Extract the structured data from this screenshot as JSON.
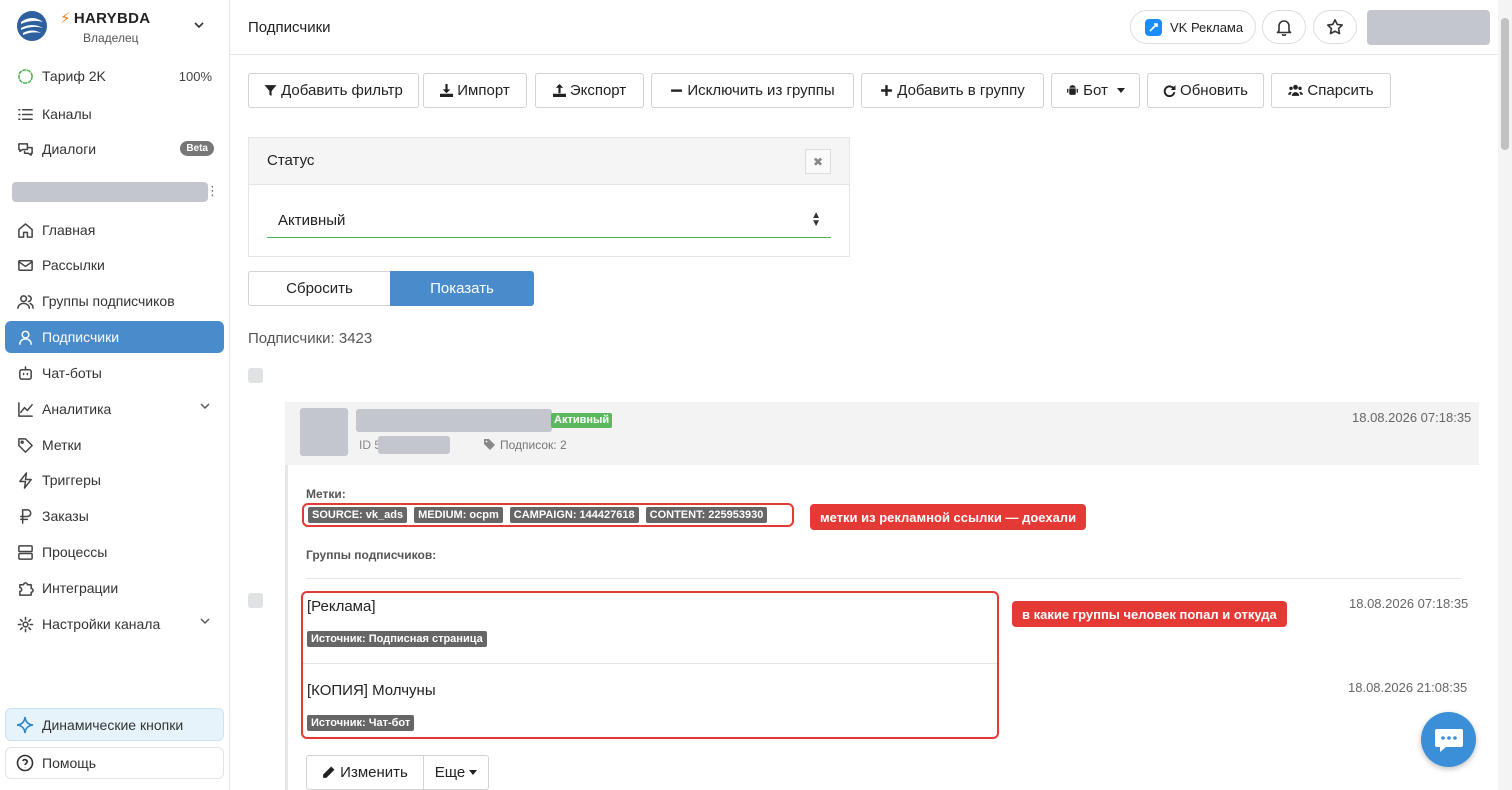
{
  "brand": {
    "name": "HARYBDA",
    "role": "Владелец"
  },
  "sidebar": {
    "plan": {
      "label": "Тариф 2K",
      "percent": "100%"
    },
    "top_items": [
      {
        "label": "Каналы"
      },
      {
        "label": "Диалоги",
        "badge": "Beta"
      }
    ],
    "items": [
      {
        "label": "Главная"
      },
      {
        "label": "Рассылки"
      },
      {
        "label": "Группы подписчиков"
      },
      {
        "label": "Подписчики"
      },
      {
        "label": "Чат-боты"
      },
      {
        "label": "Аналитика"
      },
      {
        "label": "Метки"
      },
      {
        "label": "Триггеры"
      },
      {
        "label": "Заказы"
      },
      {
        "label": "Процессы"
      },
      {
        "label": "Интеграции"
      },
      {
        "label": "Настройки канала"
      }
    ],
    "dynamic_buttons": "Динамические кнопки",
    "help": "Помощь"
  },
  "header": {
    "title": "Подписчики",
    "vk_ads": "VK Реклама"
  },
  "toolbar": {
    "add_filter": "Добавить фильтр",
    "import": "Импорт",
    "export": "Экспорт",
    "exclude": "Исключить из группы",
    "add_to_group": "Добавить в группу",
    "bot": "Бот",
    "refresh": "Обновить",
    "parse": "Спарсить"
  },
  "filter": {
    "title": "Статус",
    "close": "✖",
    "selected": "Активный",
    "reset": "Сбросить",
    "show": "Показать"
  },
  "list": {
    "count_label": "Подписчики: 3423"
  },
  "subscriber": {
    "status": "Активный",
    "id_prefix": "ID 5",
    "subscriptions": "Подписок: 2",
    "date": "18.08.2026 07:18:35",
    "tags_label": "Метки:",
    "tags": [
      "SOURCE: vk_ads",
      "MEDIUM: ocpm",
      "CAMPAIGN: 144427618",
      "CONTENT: 225953930"
    ],
    "groups_label": "Группы подписчиков:",
    "groups": [
      {
        "name": "[Реклама]",
        "source": "Источник: Подписная страница",
        "date": "18.08.2026 07:18:35"
      },
      {
        "name": "[КОПИЯ] Молчуны",
        "source": "Источник: Чат-бот",
        "date": "18.08.2026 21:08:35"
      }
    ],
    "edit": "Изменить",
    "more": "Еще"
  },
  "annotations": {
    "tags_note": "метки из рекламной ссылки — доехали",
    "groups_note": "в какие группы человек попал и откуда"
  },
  "colors": {
    "accent": "#4a8bcc",
    "active_green": "#5cb85c",
    "annotation_red": "#e53935"
  }
}
